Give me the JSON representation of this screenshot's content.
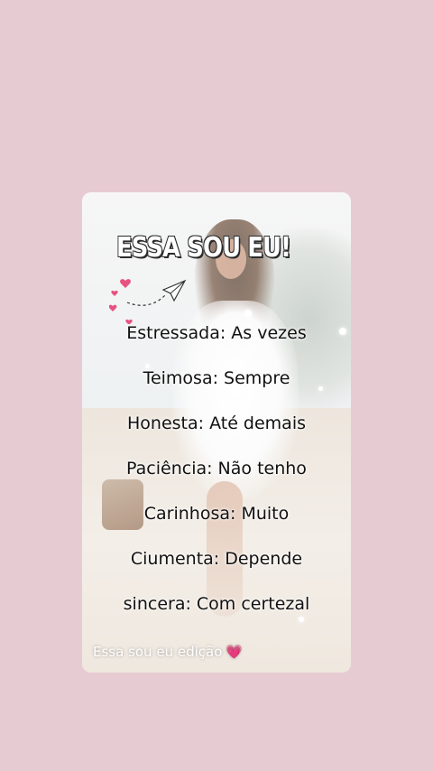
{
  "card": {
    "headline": "ESSA SOU EU!",
    "lines": [
      "Estressada: As vezes",
      "Teimosa: Sempre",
      "Honesta: Até demais",
      "Paciência: Não tenho",
      "Carinhosa: Muito",
      "Ciumenta: Depende",
      "sincera: Com certezal"
    ],
    "footer_text": "Essa sou eu edição",
    "footer_heart": "💗"
  },
  "icons": {
    "paper_plane": "paper-plane-icon",
    "hearts": "heart-icon"
  },
  "colors": {
    "background": "#e7cbd3",
    "heart_pink": "#e7527f",
    "text": "#111111"
  }
}
